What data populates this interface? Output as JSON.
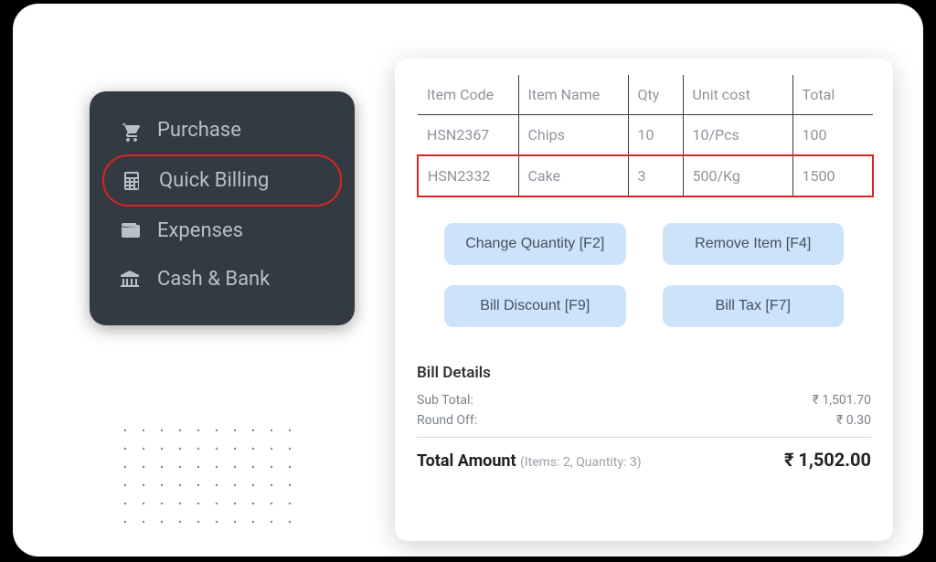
{
  "sidebar": {
    "items": [
      {
        "label": "Purchase",
        "icon": "cart"
      },
      {
        "label": "Quick Billing",
        "icon": "calculator"
      },
      {
        "label": "Expenses",
        "icon": "wallet"
      },
      {
        "label": "Cash & Bank",
        "icon": "bank"
      }
    ],
    "selected_index": 1
  },
  "table": {
    "headers": [
      "Item Code",
      "Item Name",
      "Qty",
      "Unit cost",
      "Total"
    ],
    "rows": [
      {
        "code": "HSN2367",
        "name": "Chips",
        "qty": "10",
        "unit": "10/Pcs",
        "total": "100",
        "highlight": false
      },
      {
        "code": "HSN2332",
        "name": "Cake",
        "qty": "3",
        "unit": "500/Kg",
        "total": "1500",
        "highlight": true
      }
    ]
  },
  "actions": {
    "change_qty": "Change Quantity [F2]",
    "remove_item": "Remove Item [F4]",
    "bill_discount": "Bill Discount [F9]",
    "bill_tax": "Bill Tax [F7]"
  },
  "details": {
    "title": "Bill Details",
    "sub_total_label": "Sub Total:",
    "sub_total_value": "₹ 1,501.70",
    "round_off_label": "Round Off:",
    "round_off_value": "₹ 0.30",
    "total_label": "Total Amount",
    "total_sub": "(Items: 2, Quantity: 3)",
    "total_value": "₹ 1,502.00"
  }
}
